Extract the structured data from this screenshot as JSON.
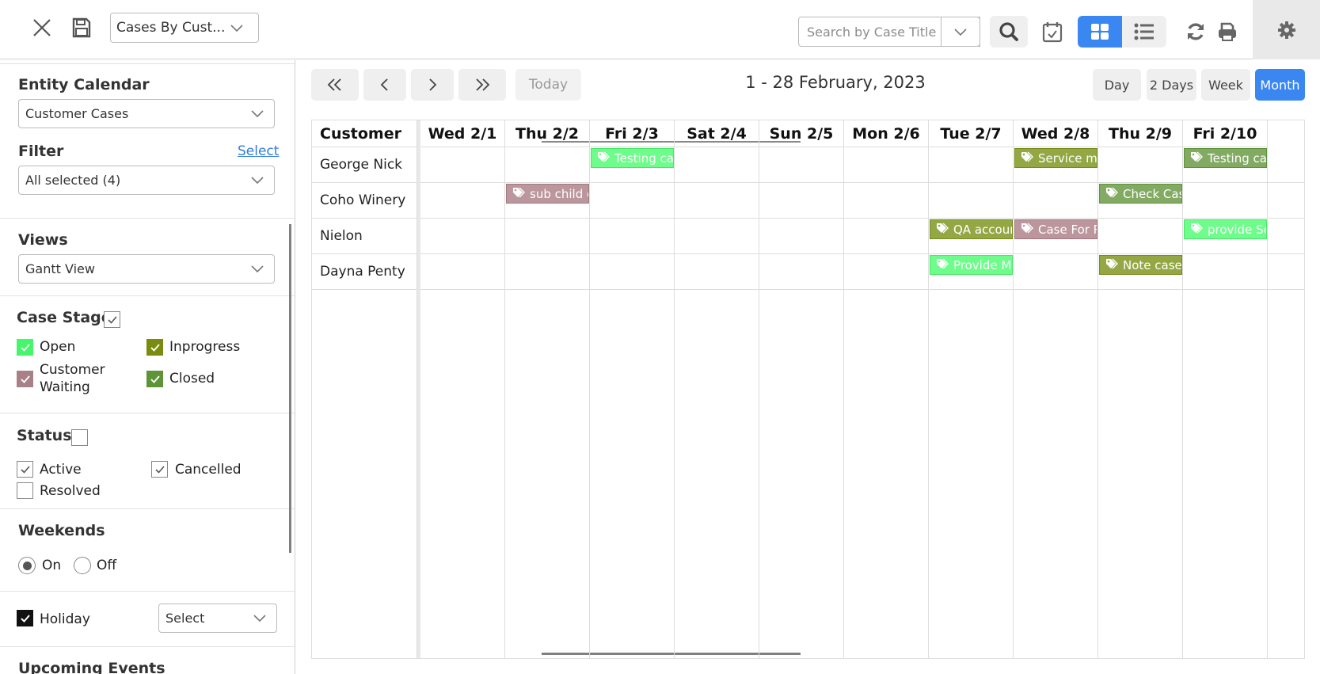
{
  "topbar": {
    "view_selector_value": "Cases By Cust...",
    "search_placeholder": "Search by Case Title",
    "icons": {
      "close": "close-icon",
      "save": "save-icon",
      "search": "search-icon",
      "calendar": "calendar-check-icon",
      "grid": "grid-view-icon",
      "list": "list-view-icon",
      "refresh": "refresh-icon",
      "print": "print-icon",
      "settings": "gear-icon"
    }
  },
  "sidebar": {
    "entity_calendar": {
      "label": "Entity Calendar",
      "value": "Customer Cases"
    },
    "filter": {
      "label": "Filter",
      "link": "Select",
      "value": "All selected (4)"
    },
    "views": {
      "label": "Views",
      "value": "Gantt View"
    },
    "case_stage": {
      "label": "Case Stage",
      "all_checked": true,
      "items": [
        {
          "label": "Open",
          "checked": true,
          "color": "#45f56a"
        },
        {
          "label": "Inprogress",
          "checked": true,
          "color": "#7a8b10"
        },
        {
          "label": "Customer Waiting",
          "checked": true,
          "color": "#a88188"
        },
        {
          "label": "Closed",
          "checked": true,
          "color": "#5e9338"
        }
      ]
    },
    "status": {
      "label": "Status",
      "all_checked": false,
      "items": [
        {
          "label": "Active",
          "checked": true
        },
        {
          "label": "Cancelled",
          "checked": true
        },
        {
          "label": "Resolved",
          "checked": false
        }
      ]
    },
    "weekends": {
      "label": "Weekends",
      "options": [
        "On",
        "Off"
      ],
      "selected": "On"
    },
    "holiday": {
      "label": "Holiday",
      "checked": true,
      "select_value": "Select"
    },
    "upcoming_events": {
      "label": "Upcoming Events"
    }
  },
  "toolbar": {
    "today": "Today",
    "range_title": "1 - 28 February, 2023",
    "modes": [
      "Day",
      "2 Days",
      "Week",
      "Month"
    ],
    "active_mode": "Month"
  },
  "grid": {
    "resource_header": "Customer",
    "days": [
      "Wed 2/1",
      "Thu 2/2",
      "Fri 2/3",
      "Sat 2/4",
      "Sun 2/5",
      "Mon 2/6",
      "Tue 2/7",
      "Wed 2/8",
      "Thu 2/9",
      "Fri 2/10"
    ],
    "resources": [
      "George Nick",
      "Coho Winery",
      "Nielon",
      "Dayna Penty"
    ],
    "events": [
      {
        "title": "Testing case",
        "resource": 0,
        "day": 2,
        "stage": "Open"
      },
      {
        "title": "Service maintenance",
        "resource": 0,
        "day": 7,
        "stage": "Inprogress"
      },
      {
        "title": "Testing case",
        "resource": 0,
        "day": 9,
        "stage": "Closed"
      },
      {
        "title": "sub child case",
        "resource": 1,
        "day": 1,
        "stage": "Customer Waiting"
      },
      {
        "title": "Check Case ...",
        "resource": 1,
        "day": 8,
        "stage": "Closed"
      },
      {
        "title": "QA account",
        "resource": 2,
        "day": 6,
        "stage": "Inprogress"
      },
      {
        "title": "Case For Repair",
        "resource": 2,
        "day": 7,
        "stage": "Customer Waiting"
      },
      {
        "title": "provide Service",
        "resource": 2,
        "day": 9,
        "stage": "Open"
      },
      {
        "title": "Provide Maintenance",
        "resource": 3,
        "day": 6,
        "stage": "Open"
      },
      {
        "title": "Note case",
        "resource": 3,
        "day": 8,
        "stage": "Inprogress"
      }
    ],
    "stage_colors": {
      "Open": {
        "bg": "#6efc8b",
        "border": "#47e868"
      },
      "Inprogress": {
        "bg": "#93a845",
        "border": "#7a8b18"
      },
      "Customer Waiting": {
        "bg": "#bb969c",
        "border": "#a0787f"
      },
      "Closed": {
        "bg": "#82aa62",
        "border": "#5e9338"
      }
    }
  },
  "colors": {
    "accent": "#3b87f1",
    "link": "#2f7de1"
  }
}
